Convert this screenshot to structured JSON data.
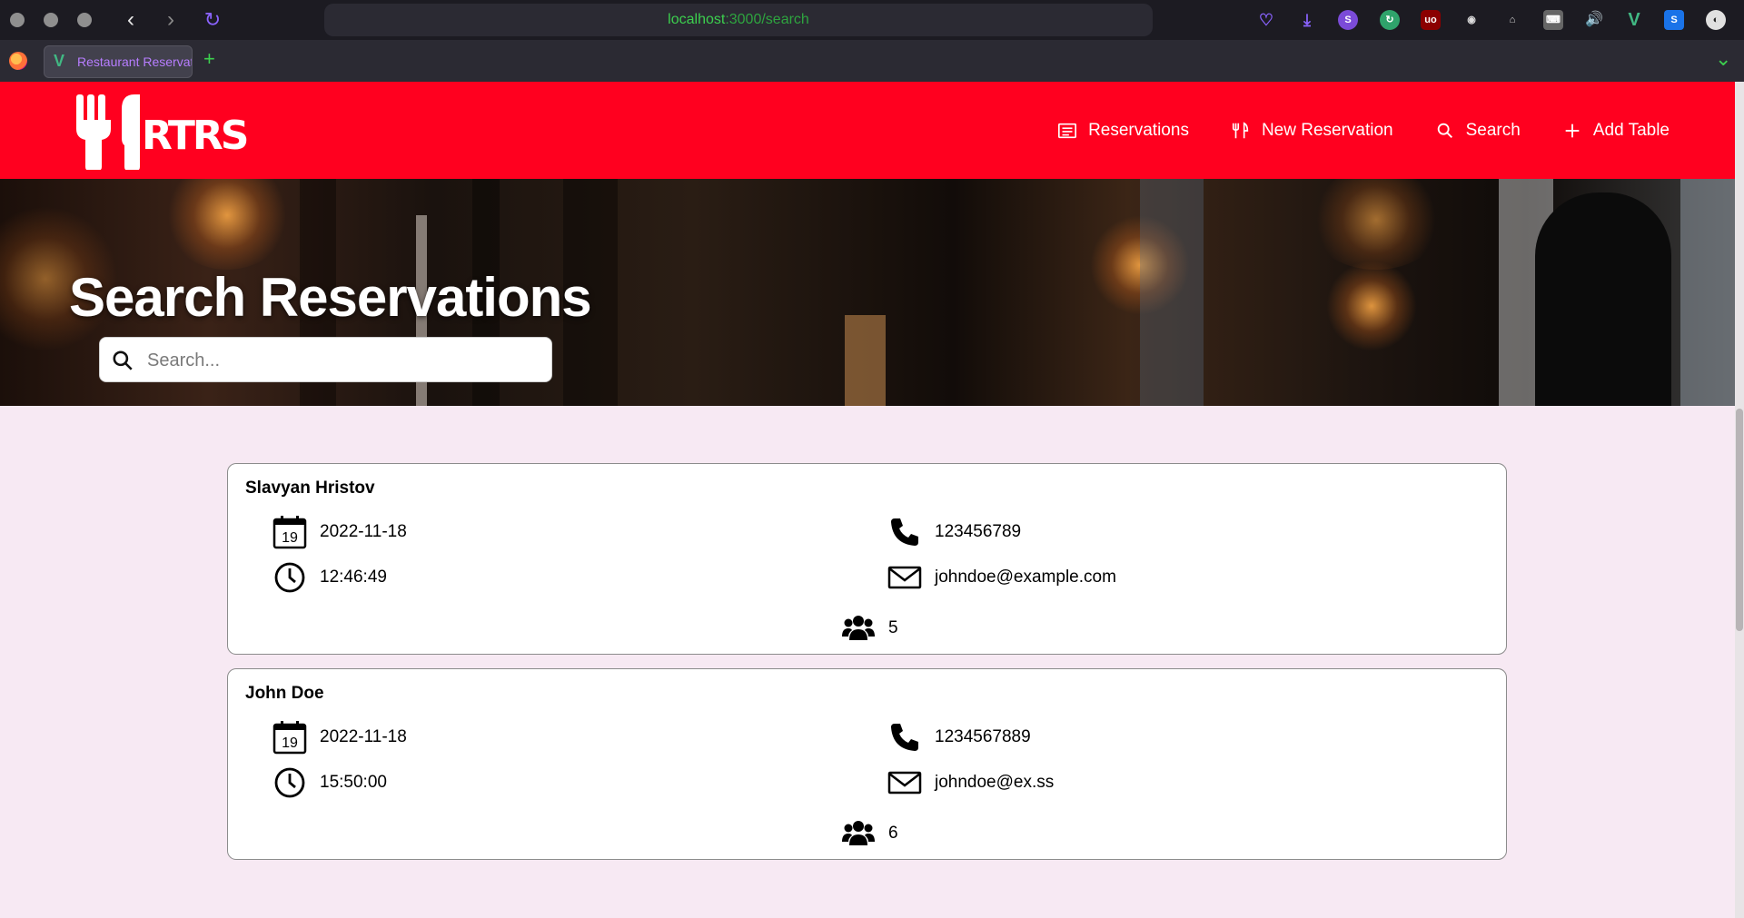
{
  "browser": {
    "url_host": "localhost",
    "url_rest": ":3000/search",
    "tab_title": "Restaurant Reservations",
    "new_tab_symbol": "+"
  },
  "app": {
    "logo_text": "RTRS",
    "brand_color": "#ff001f",
    "nav": [
      {
        "label": "Reservations",
        "icon": "list-icon"
      },
      {
        "label": "New Reservation",
        "icon": "fork-knife-icon"
      },
      {
        "label": "Search",
        "icon": "search-icon"
      },
      {
        "label": "Add Table",
        "icon": "plus-icon"
      }
    ]
  },
  "hero": {
    "title": "Search Reservations",
    "search_placeholder": "Search..."
  },
  "reservations": [
    {
      "name": "Slavyan Hristov",
      "date": "2022-11-18",
      "calendar_day": "19",
      "time": "12:46:49",
      "phone": "123456789",
      "email": "johndoe@example.com",
      "guests": "5"
    },
    {
      "name": "John Doe",
      "date": "2022-11-18",
      "calendar_day": "19",
      "time": "15:50:00",
      "phone": "1234567889",
      "email": "johndoe@ex.ss",
      "guests": "6"
    }
  ]
}
